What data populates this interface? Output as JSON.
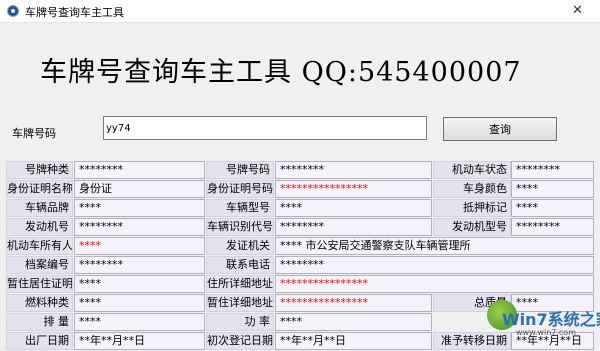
{
  "window": {
    "title": "车牌号查询车主工具",
    "close_glyph": "✕"
  },
  "header": {
    "title": "车牌号查询车主工具 QQ:545400007"
  },
  "search": {
    "label": "车牌号码",
    "value": "yy74",
    "button": "查询"
  },
  "fields": [
    [
      {
        "label": "号牌种类",
        "value": "********"
      },
      {
        "label": "号牌号码",
        "value": "********"
      },
      {
        "label": "机动车状态",
        "value": "********"
      }
    ],
    [
      {
        "label": "身份证明名称",
        "value": "身份证"
      },
      {
        "label": "身份证明号码",
        "value": "****************"
      },
      {
        "label": "车身颜色",
        "value": "****"
      }
    ],
    [
      {
        "label": "车辆品牌",
        "value": "****"
      },
      {
        "label": "车辆型号",
        "value": "****"
      },
      {
        "label": "抵押标记",
        "value": "****"
      }
    ],
    [
      {
        "label": "发动机号",
        "value": "********"
      },
      {
        "label": "车辆识别代号",
        "value": "********"
      },
      {
        "label": "发动机型号",
        "value": "********"
      }
    ],
    [
      {
        "label": "机动车所有人",
        "value": "****"
      },
      {
        "label": "发证机关",
        "value": "**** 市公安局交通警察支队车辆管理所"
      }
    ],
    [
      {
        "label": "档案编号",
        "value": "********"
      },
      {
        "label": "联系电话",
        "value": "********"
      }
    ],
    [
      {
        "label": "暂住居住证明",
        "value": "****"
      },
      {
        "label": "住所详细地址",
        "value": "****************"
      }
    ],
    [
      {
        "label": "燃料种类",
        "value": "****"
      },
      {
        "label": "暂住详细地址",
        "value": "****************"
      },
      {
        "label": "总质量",
        "value": "****"
      }
    ],
    [
      {
        "label": "排    量",
        "value": "****"
      },
      {
        "label": "功    率",
        "value": "****"
      }
    ],
    [
      {
        "label": "出厂日期",
        "value": "**年**月**日"
      },
      {
        "label": "初次登记日期",
        "value": "**年**月**日"
      },
      {
        "label": "准予转移日期",
        "value": "**年**月**日"
      }
    ]
  ],
  "watermark": {
    "text": "Win7系统之家",
    "url": "www.win7.com"
  },
  "colors": {
    "accent_red": "#ff0000",
    "label_bg": "#e3e3f0",
    "value_bg": "#f6f2fb"
  }
}
